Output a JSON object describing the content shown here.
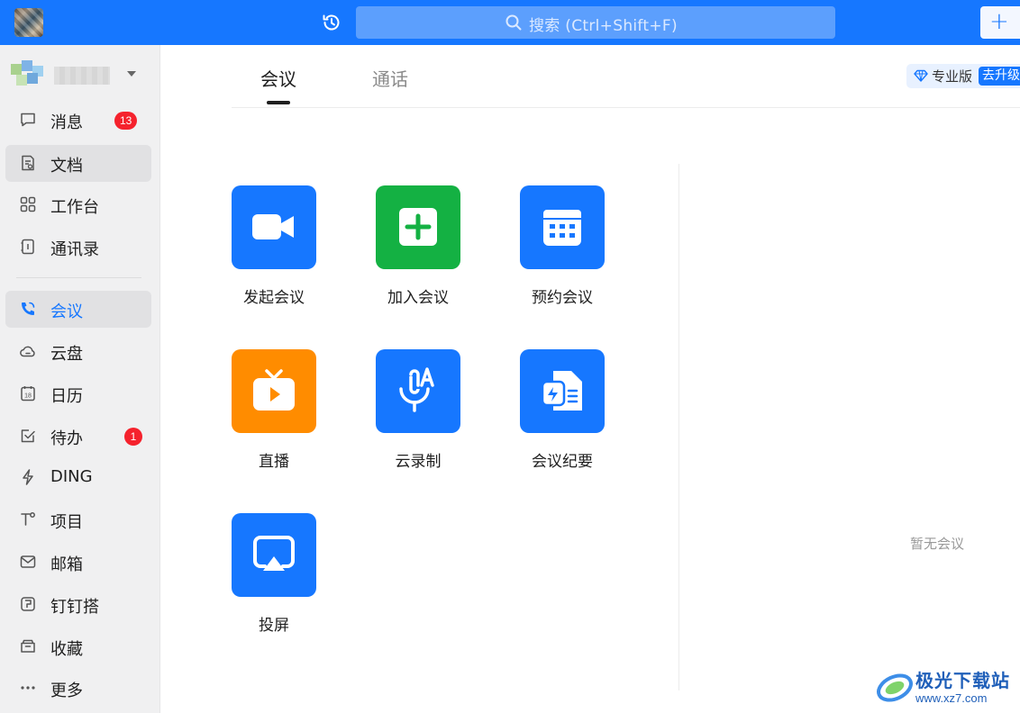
{
  "search": {
    "placeholder": "搜索 (Ctrl+Shift+F)"
  },
  "sidebar": {
    "items": [
      {
        "label": "消息",
        "badge": "13"
      },
      {
        "label": "文档"
      },
      {
        "label": "工作台"
      },
      {
        "label": "通讯录"
      },
      {
        "label": "会议"
      },
      {
        "label": "云盘"
      },
      {
        "label": "日历",
        "icon_text": "18"
      },
      {
        "label": "待办",
        "badge": "1"
      },
      {
        "label": "DING"
      },
      {
        "label": "项目"
      },
      {
        "label": "邮箱"
      },
      {
        "label": "钉钉搭"
      },
      {
        "label": "收藏"
      },
      {
        "label": "更多"
      }
    ]
  },
  "main": {
    "tabs": [
      {
        "label": "会议"
      },
      {
        "label": "通话"
      }
    ],
    "plan": {
      "label": "专业版",
      "upgrade_label": "去升级"
    },
    "apps": [
      {
        "label": "发起会议",
        "icon": "video-camera-icon",
        "color": "#1677ff"
      },
      {
        "label": "加入会议",
        "icon": "plus-square-icon",
        "color": "#14b143"
      },
      {
        "label": "预约会议",
        "icon": "calendar-icon",
        "color": "#1677ff"
      },
      {
        "label": "直播",
        "icon": "tv-play-icon",
        "color": "#ff8c00"
      },
      {
        "label": "云录制",
        "icon": "mic-text-icon",
        "color": "#1677ff"
      },
      {
        "label": "会议纪要",
        "icon": "minutes-doc-icon",
        "color": "#1677ff"
      },
      {
        "label": "投屏",
        "icon": "screen-cast-icon",
        "color": "#1677ff"
      }
    ],
    "empty_text": "暂无会议"
  },
  "watermark": {
    "title": "极光下载站",
    "url": "www.xz7.com"
  },
  "colors": {
    "brand": "#1677ff",
    "badge": "#f5222d",
    "sidebar_bg": "#f0f0f1"
  }
}
